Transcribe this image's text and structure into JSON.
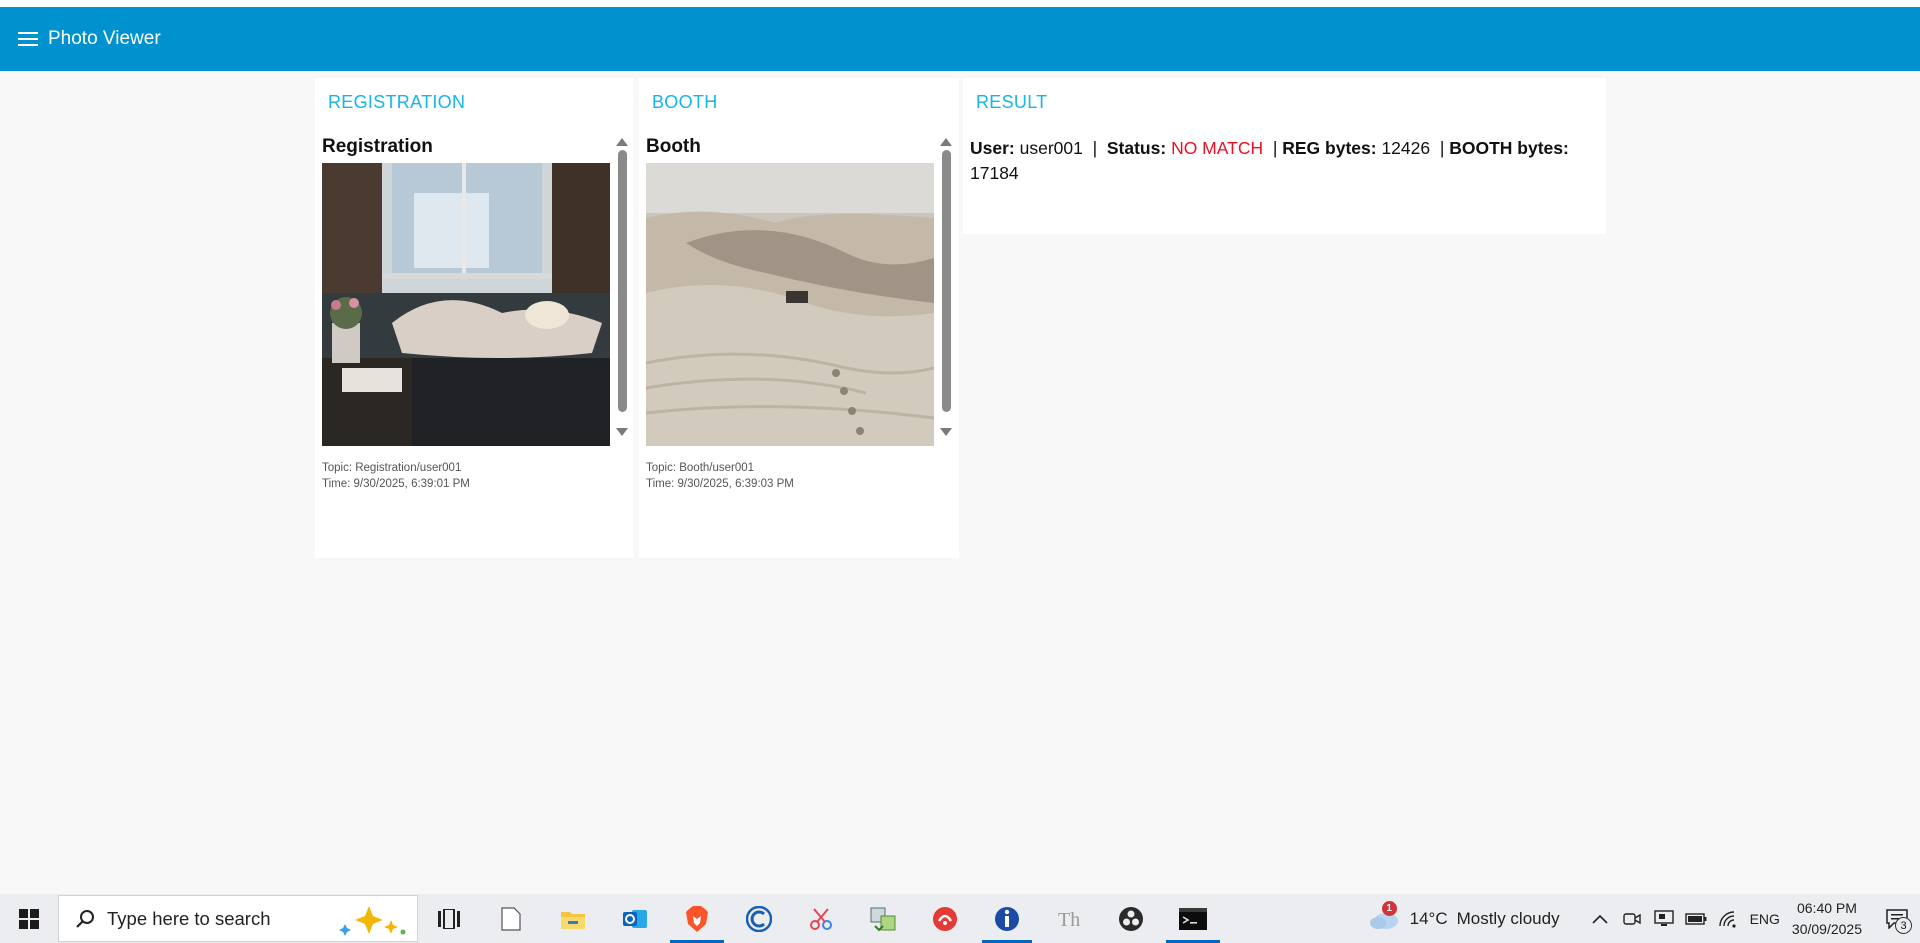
{
  "app": {
    "title": "Photo Viewer"
  },
  "registration": {
    "header": "REGISTRATION",
    "caption": "Registration",
    "topic": "Topic: Registration/user001",
    "time": "Time: 9/30/2025, 6:39:01 PM"
  },
  "booth": {
    "header": "BOOTH",
    "caption": "Booth",
    "topic": "Topic: Booth/user001",
    "time": "Time: 9/30/2025, 6:39:03 PM"
  },
  "result": {
    "header": "RESULT",
    "user_label": "User:",
    "user_value": "user001",
    "status_label": "Status:",
    "status_value": "NO MATCH",
    "reg_bytes_label": "REG bytes:",
    "reg_bytes_value": "12426",
    "booth_bytes_label": "BOOTH bytes:",
    "booth_bytes_value": "17184",
    "status_color": "#e81123"
  },
  "taskbar": {
    "search_placeholder": "Type here to search",
    "weather_temp": "14°C",
    "weather_desc": "Mostly cloudy",
    "weather_badge": "1",
    "language": "ENG",
    "time": "06:40 PM",
    "date": "30/09/2025",
    "notification_count": "3",
    "apps": [
      "task-view",
      "file",
      "file-explorer",
      "outlook",
      "brave",
      "ccleaner",
      "snipping-tool",
      "network-transfer",
      "pdf-app",
      "intel-app",
      "typora",
      "obs",
      "terminal"
    ]
  },
  "colors": {
    "appbar": "#0091cf",
    "panel_header": "#16b5ea",
    "accent": "#0067c0"
  }
}
